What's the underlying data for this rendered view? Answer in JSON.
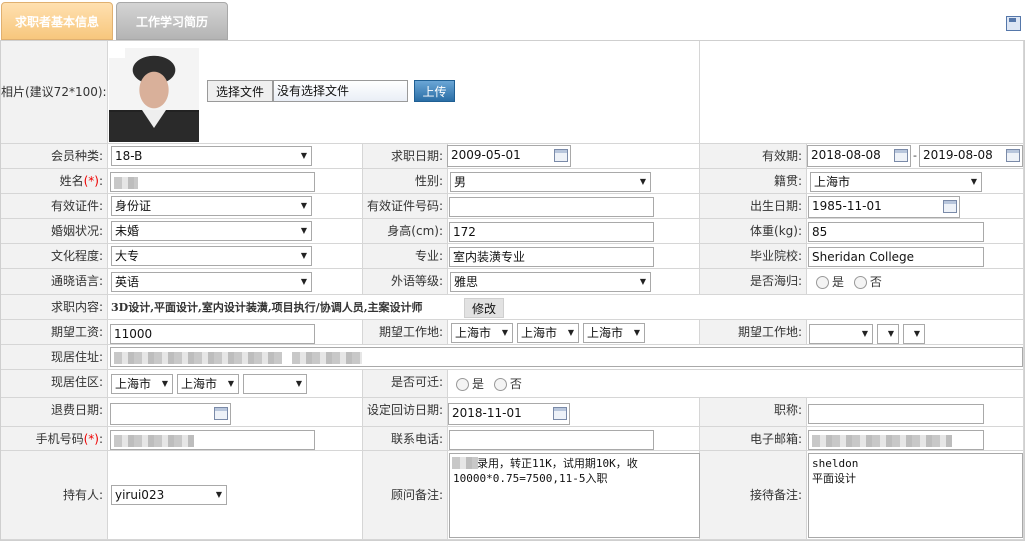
{
  "tabs": [
    "求职者基本信息",
    "工作学习简历"
  ],
  "photo": {
    "label": "相片(建议72*100):",
    "choose_button": "选择文件",
    "no_file": "没有选择文件",
    "upload_button": "上传"
  },
  "fields": {
    "member_type": {
      "label": "会员种类:",
      "value": "18-B"
    },
    "job_date": {
      "label": "求职日期:",
      "value": "2009-05-01"
    },
    "valid_period": {
      "label": "有效期:",
      "start": "2018-08-08",
      "sep": "-",
      "end": "2019-08-08"
    },
    "name": {
      "label": "姓名",
      "req": "(*)",
      "colon": ":"
    },
    "gender": {
      "label": "性别:",
      "value": "男"
    },
    "hometown": {
      "label": "籍贯:",
      "value": "上海市"
    },
    "id_type": {
      "label": "有效证件:",
      "value": "身份证"
    },
    "id_number": {
      "label": "有效证件号码:",
      "value": ""
    },
    "birth_date": {
      "label": "出生日期:",
      "value": "1985-11-01"
    },
    "marital": {
      "label": "婚姻状况:",
      "value": "未婚"
    },
    "height": {
      "label": "身高(cm):",
      "value": "172"
    },
    "weight": {
      "label": "体重(kg):",
      "value": "85"
    },
    "education": {
      "label": "文化程度:",
      "value": "大专"
    },
    "major": {
      "label": "专业:",
      "value": "室内装潢专业"
    },
    "school": {
      "label": "毕业院校:",
      "value": "Sheridan College"
    },
    "language": {
      "label": "通晓语言:",
      "value": "英语"
    },
    "foreign_level": {
      "label": "外语等级:",
      "value": "雅思"
    },
    "returnee": {
      "label": "是否海归:",
      "yes": "是",
      "no": "否"
    },
    "job_content": {
      "label": "求职内容:",
      "value": "3D设计,平面设计,室内设计装潢,项目执行/协调人员,主案设计师",
      "modify_button": "修改"
    },
    "expected_salary": {
      "label": "期望工资:",
      "value": "11000"
    },
    "expected_location": {
      "label": "期望工作地:",
      "p1": "上海市",
      "p2": "上海市",
      "p3": "上海市"
    },
    "expected_location2": {
      "label": "期望工作地:"
    },
    "address": {
      "label": "现居住址:"
    },
    "district": {
      "label": "现居住区:",
      "p1": "上海市",
      "p2": "上海市"
    },
    "relocate": {
      "label": "是否可迁:",
      "yes": "是",
      "no": "否"
    },
    "refund_date": {
      "label": "退费日期:",
      "value": ""
    },
    "callback_date": {
      "label": "设定回访日期:",
      "value": "2018-11-01"
    },
    "title": {
      "label": "职称:",
      "value": ""
    },
    "mobile": {
      "label": "手机号码",
      "req": "(*)",
      "colon": ":"
    },
    "phone": {
      "label": "联系电话:",
      "value": ""
    },
    "email": {
      "label": "电子邮箱:"
    },
    "holder": {
      "label": "持有人:",
      "value": "yirui023"
    },
    "advisor_note": {
      "label": "顾问备注:",
      "value": "录用，转正11K，试用期10K，收\n10000*0.75=7500,11-5入职"
    },
    "reception_note": {
      "label": "接待备注:",
      "value": "sheldon\n平面设计"
    }
  }
}
